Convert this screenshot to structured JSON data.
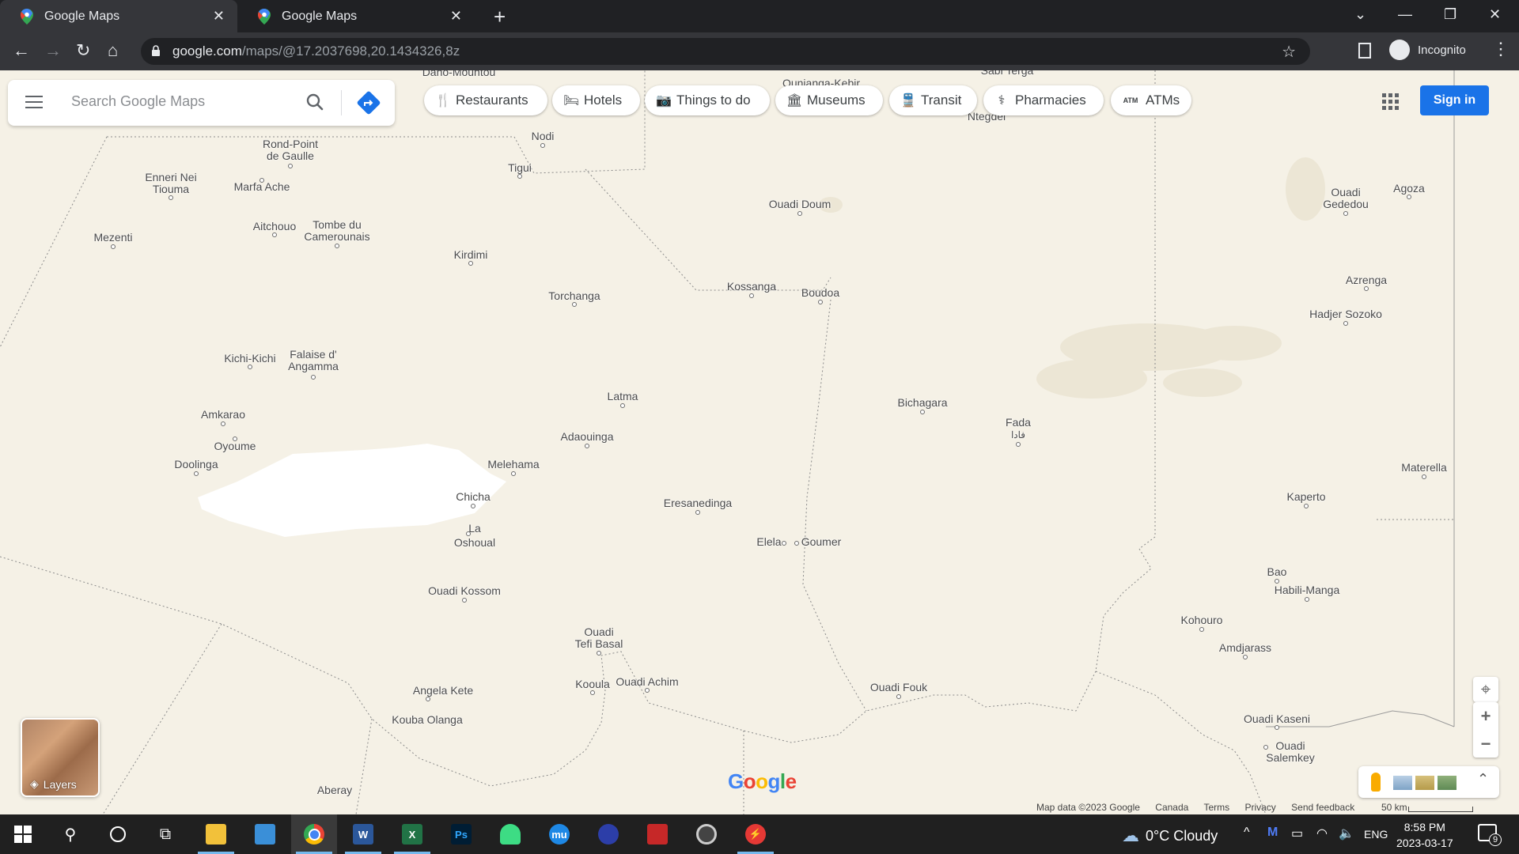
{
  "browser": {
    "tabs": [
      {
        "title": "Google Maps"
      },
      {
        "title": "Google Maps"
      }
    ],
    "url_host": "google.com",
    "url_path": "/maps/@17.2037698,20.1434326,8z",
    "incognito_label": "Incognito"
  },
  "maps": {
    "search_placeholder": "Search Google Maps",
    "chips": [
      "Restaurants",
      "Hotels",
      "Things to do",
      "Museums",
      "Transit",
      "Pharmacies",
      "ATMs"
    ],
    "sign_in": "Sign in",
    "layers_label": "Layers",
    "logo": "Google",
    "attribution": {
      "map_data": "Map data ©2023 Google",
      "country": "Canada",
      "terms": "Terms",
      "privacy": "Privacy",
      "feedback": "Send feedback",
      "scale": "50 km"
    },
    "places": [
      "Dano-Mountou",
      "Ounianga-Kebir",
      "Sabi Terga",
      "Ntegdei",
      "Nodi",
      "Rond-Point\nde Gaulle",
      "Tigui",
      "Enneri Nei\nTiouma",
      "Marfa Ache",
      "Ouadi Doum",
      "Ouadi\nGededou",
      "Agoza",
      "Aitchouo",
      "Tombe du\nCamerounais",
      "Mezenti",
      "Kirdimi",
      "Kossanga",
      "Boudoa",
      "Torchanga",
      "Azrenga",
      "Hadjer Sozoko",
      "Kichi-Kichi",
      "Falaise d'\nAngamma",
      "Latma",
      "Bichagara",
      "Amkarao",
      "Fada",
      "فادا",
      "Adaouinga",
      "Oyoume",
      "Doolinga",
      "Melehama",
      "Materella",
      "Chicha",
      "Eresanedinga",
      "Kaperto",
      "La\nOshoual",
      "Elela",
      "Goumer",
      "Ouadi Kossom",
      "Bao",
      "Habili-Manga",
      "Kohouro",
      "Ouadi\nTefi Basal",
      "Amdjarass",
      "Angela Kete",
      "Kooula",
      "Ouadi Achim",
      "Ouadi Fouk",
      "Kouba Olanga",
      "Ouadi Kaseni",
      "Ouadi\nSalemkey",
      "Aberay"
    ]
  },
  "taskbar": {
    "weather": "0°C  Cloudy",
    "lang": "ENG",
    "time": "8:58 PM",
    "date": "2023-03-17",
    "notif_count": "9"
  },
  "colors": {
    "map_bg": "#f5f1e6",
    "accent_blue": "#1a73e8",
    "chrome_dark": "#202124",
    "chrome_mid": "#35363a"
  }
}
